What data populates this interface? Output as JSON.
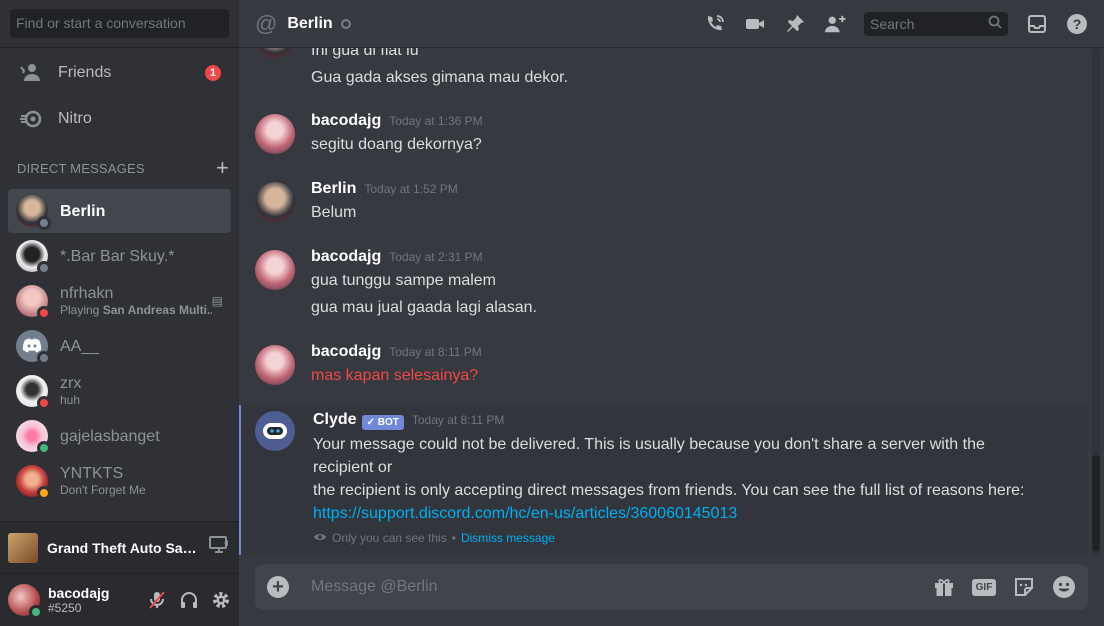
{
  "sidebar": {
    "search_placeholder": "Find or start a conversation",
    "nav": [
      {
        "label": "Friends",
        "badge": "1"
      },
      {
        "label": "Nitro"
      }
    ],
    "dm_header": "DIRECT MESSAGES",
    "dms": [
      {
        "name": "Berlin",
        "sub": "",
        "status": "offline",
        "active": true,
        "color": "#5a5e66"
      },
      {
        "name": "*.Bar Bar Skuy.*",
        "sub": "",
        "status": "offline",
        "color": "#e6e6e6"
      },
      {
        "name": "nfrhakn",
        "sub_prefix": "Playing ",
        "sub_bold": "San Andreas Multi...",
        "status": "dnd",
        "color": "#d8a0a8"
      },
      {
        "name": "AA__",
        "sub": "",
        "status": "offline",
        "color": "#747f8d"
      },
      {
        "name": "zrx",
        "sub": "huh",
        "status": "dnd",
        "color": "#f2f2f2"
      },
      {
        "name": "gajelasbanget",
        "sub": "",
        "status": "online",
        "color": "#f7c6d8"
      },
      {
        "name": "YNTKTS",
        "sub": "Don't Forget Me",
        "status": "idle",
        "color": "#c23a3a"
      }
    ],
    "now_playing": "Grand Theft Auto San ...",
    "user": {
      "name": "bacodajg",
      "tag": "#5250"
    }
  },
  "topbar": {
    "channel": "Berlin",
    "search_placeholder": "Search"
  },
  "messages": [
    {
      "id": "g0",
      "author": "",
      "time": "",
      "lines": [
        "Ini gua di flat lu",
        "Gua gada akses gimana mau dekor."
      ]
    },
    {
      "id": "g1",
      "author": "bacodajg",
      "time": "Today at 1:36 PM",
      "lines": [
        "segitu doang dekornya?"
      ]
    },
    {
      "id": "g2",
      "author": "Berlin",
      "time": "Today at 1:52 PM",
      "lines": [
        "Belum"
      ]
    },
    {
      "id": "g3",
      "author": "bacodajg",
      "time": "Today at 2:31 PM",
      "lines": [
        "gua tunggu sampe malem",
        "gua mau jual gaada lagi alasan."
      ]
    },
    {
      "id": "g4",
      "author": "bacodajg",
      "time": "Today at 8:11 PM",
      "lines": [
        "mas kapan selesainya?"
      ]
    }
  ],
  "clyde": {
    "author": "Clyde",
    "bot_tag": "BOT",
    "time": "Today at 8:11 PM",
    "line1": "Your message could not be delivered. This is usually because you don't share a server with the recipient or",
    "line2": "the recipient is only accepting direct messages from friends. You can see the full list of reasons here:",
    "link": "https://support.discord.com/hc/en-us/articles/360060145013",
    "only_you": "Only you can see this",
    "sep": "•",
    "dismiss": "Dismiss message"
  },
  "composer": {
    "placeholder": "Message @Berlin",
    "gif": "GIF"
  },
  "colors": {
    "accent": "#7289da",
    "red": "#f04747",
    "link": "#00b0f4"
  }
}
